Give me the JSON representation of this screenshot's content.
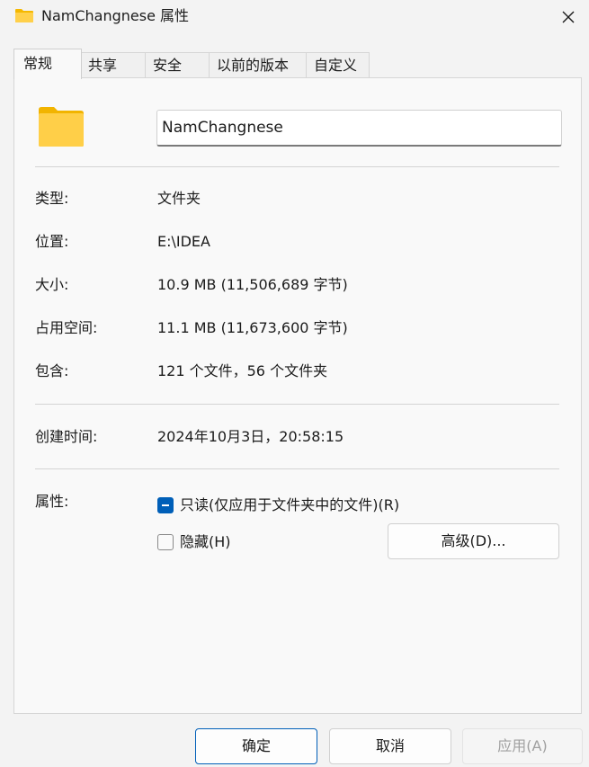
{
  "window": {
    "title": "NamChangnese 属性"
  },
  "tabs": [
    {
      "label": "常规",
      "active": true
    },
    {
      "label": "共享"
    },
    {
      "label": "安全"
    },
    {
      "label": "以前的版本"
    },
    {
      "label": "自定义"
    }
  ],
  "general": {
    "name_value": "NamChangnese",
    "rows": [
      {
        "label": "类型:",
        "value": "文件夹"
      },
      {
        "label": "位置:",
        "value": "E:\\IDEA"
      },
      {
        "label": "大小:",
        "value": "10.9 MB (11,506,689 字节)"
      },
      {
        "label": "占用空间:",
        "value": "11.1 MB (11,673,600 字节)"
      },
      {
        "label": "包含:",
        "value": "121 个文件，56 个文件夹"
      }
    ],
    "created": {
      "label": "创建时间:",
      "value": "2024年10月3日，20:58:15"
    },
    "attributes": {
      "label": "属性:",
      "readonly": {
        "label": "只读(仅应用于文件夹中的文件)(R)",
        "state": "indeterminate"
      },
      "hidden": {
        "label": "隐藏(H)",
        "checked": false
      },
      "advanced_button": "高级(D)..."
    }
  },
  "footer": {
    "ok": "确定",
    "cancel": "取消",
    "apply": "应用(A)"
  },
  "colors": {
    "accent": "#005fb8",
    "folder_yellow": "#ffca3a"
  },
  "icons": {
    "title": "folder-icon",
    "close": "close-icon",
    "large": "folder-icon"
  }
}
